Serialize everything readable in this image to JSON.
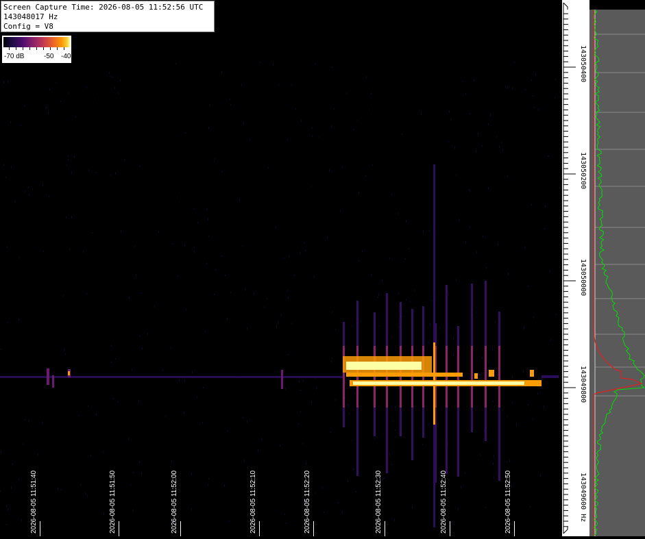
{
  "info": {
    "capture_time": "Screen Capture Time: 2026-08-05 11:52:56 UTC",
    "frequency": "143048017 Hz",
    "config": "Config = V8"
  },
  "legend": {
    "labels": [
      "-70 dB",
      "-50",
      "-40"
    ]
  },
  "time_axis": [
    "2026-08-05 11:51:40",
    "2026-08-05 11:51:50",
    "2026-08-05 11:52:00",
    "2026-08-05 11:52:10",
    "2026-08-05 11:52:20",
    "2026-08-05 11:52:30",
    "2026-08-05 11:52:40",
    "2026-08-05 11:52:50"
  ],
  "freq_axis": [
    "143050400",
    "143050200",
    "143050000",
    "143049800",
    "143049600 Hz"
  ],
  "colors": {
    "background": "#000000",
    "spectrum_panel": "#5a5a5a",
    "spectrum_trace": "#00e000",
    "spectrum_trace_peak": "#e02020",
    "signal_hot": "#fcffa4",
    "signal_warm": "#fb9b06",
    "signal_cool": "#4a0c6b"
  }
}
